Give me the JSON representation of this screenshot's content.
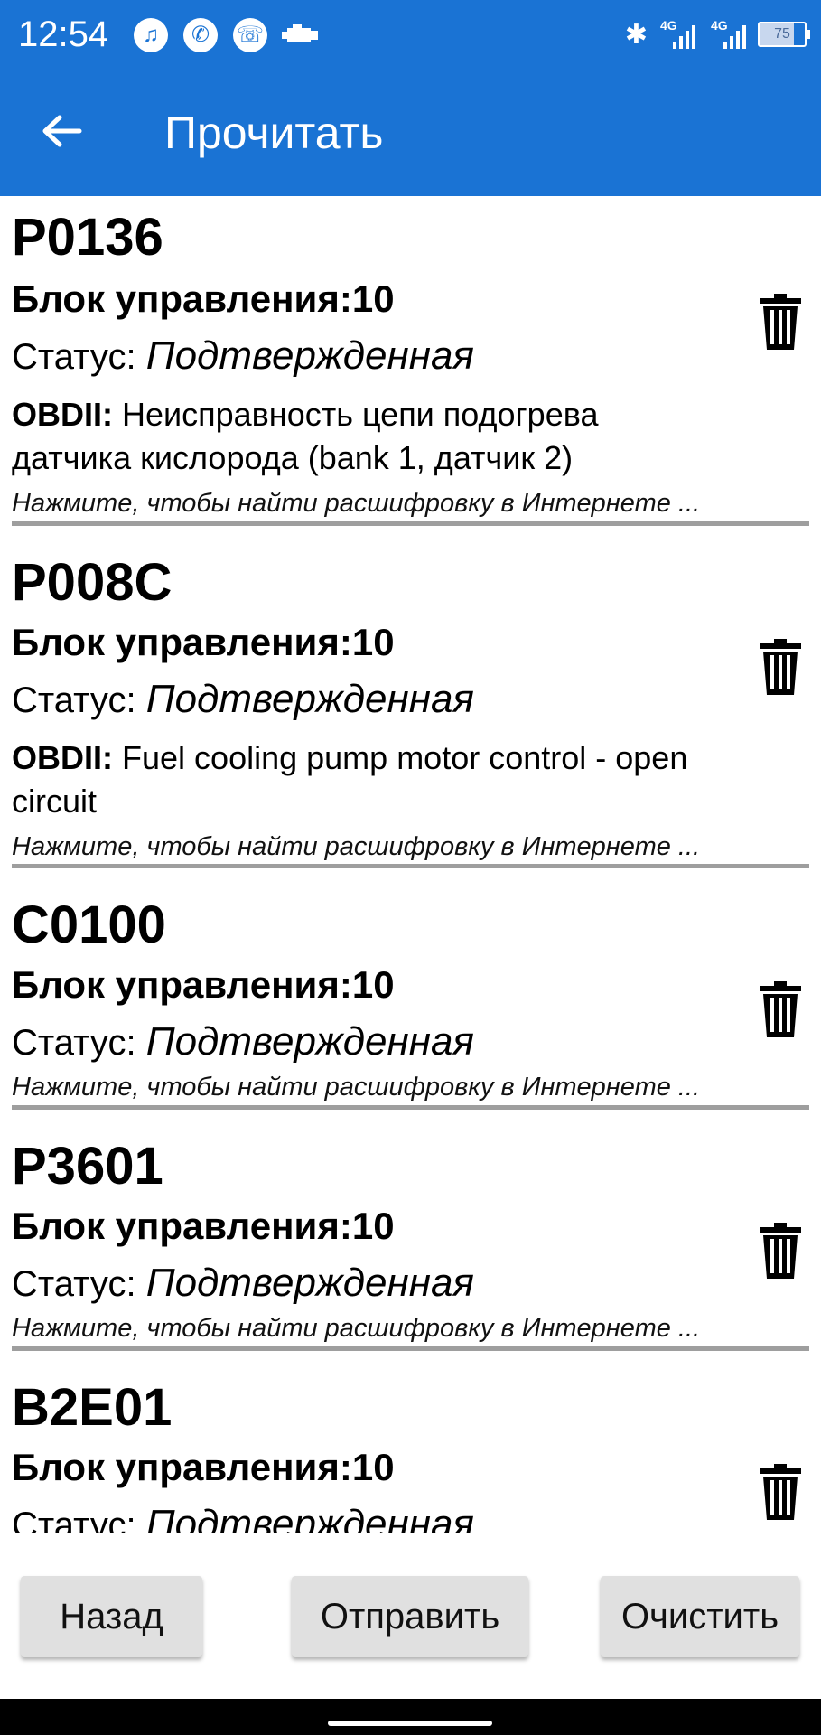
{
  "status_bar": {
    "time": "12:54",
    "icons": [
      "music-icon",
      "whatsapp-icon",
      "viber-icon",
      "engine-icon",
      "bluetooth-icon"
    ],
    "network_1": "4G",
    "network_2": "4G",
    "battery": "75",
    "battery_level": 0.75
  },
  "toolbar": {
    "title": "Прочитать",
    "back_icon": "arrow-left-icon",
    "color": "#1a73d4"
  },
  "codes": [
    {
      "code": "P0136",
      "block": "Блок управления:10",
      "status_label": "Статус:",
      "status_value": "Подтвержденная",
      "obd_label": "OBDII:",
      "obd_text": "Неисправность цепи подогрева датчика кислорода (bank 1, датчик 2)",
      "hint": "Нажмите, чтобы найти расшифровку в Интернете ..."
    },
    {
      "code": "P008C",
      "block": "Блок управления:10",
      "status_label": "Статус:",
      "status_value": "Подтвержденная",
      "obd_label": "OBDII:",
      "obd_text": "Fuel cooling pump motor control - open circuit",
      "hint": "Нажмите, чтобы найти расшифровку в Интернете ..."
    },
    {
      "code": "C0100",
      "block": "Блок управления:10",
      "status_label": "Статус:",
      "status_value": "Подтвержденная",
      "hint": "Нажмите, чтобы найти расшифровку в Интернете ..."
    },
    {
      "code": "P3601",
      "block": "Блок управления:10",
      "status_label": "Статус:",
      "status_value": "Подтвержденная",
      "hint": "Нажмите, чтобы найти расшифровку в Интернете ..."
    },
    {
      "code": "B2E01",
      "block": "Блок управления:10",
      "status_label": "Статус:",
      "status_value": "Подтвержденная"
    }
  ],
  "buttons": {
    "back": "Назад",
    "send": "Отправить",
    "clear": "Очистить"
  }
}
